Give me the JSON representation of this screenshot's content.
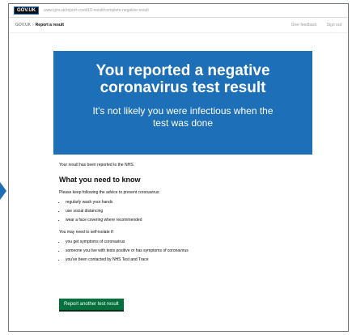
{
  "header": {
    "logo": "GOV.UK",
    "url_text": "www.gov.uk/report-covid19-result/complete-negative-result",
    "breadcrumb": [
      "GOV.UK",
      "Report a result"
    ],
    "links": [
      "Give feedback",
      "Sign out"
    ]
  },
  "banner": {
    "title": "You reported a negative coronavirus test result",
    "subtitle": "It's not likely you were infectious when the test was done"
  },
  "content": {
    "status_line": "Your result has been reported to the NHS.",
    "heading": "What you need to know",
    "intro": "Please keep following the advice to prevent coronavirus:",
    "list1": [
      "regularly wash your hands",
      "use social distancing",
      "wear a face covering where recommended"
    ],
    "intro2": "You may need to self-isolate if:",
    "list2": [
      "you get symptoms of coronavirus",
      "someone you live with tests positive or has symptoms of coronavirus",
      "you've been contacted by NHS Test and Trace"
    ],
    "button": "Report another test result"
  }
}
